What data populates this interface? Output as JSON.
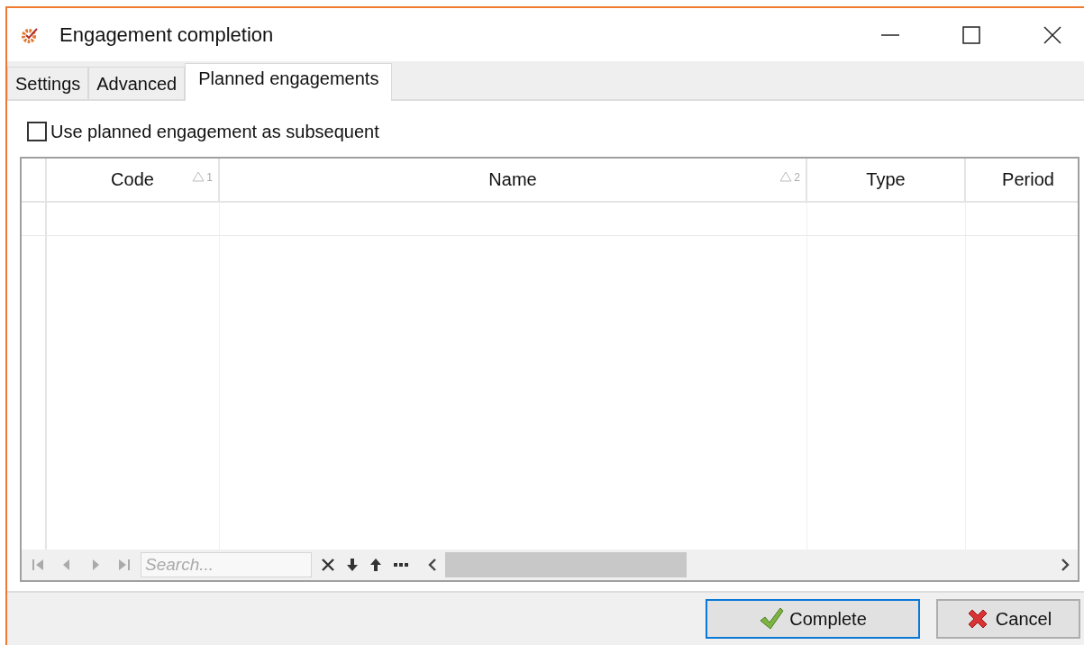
{
  "window": {
    "title": "Engagement completion"
  },
  "tabs": [
    {
      "label": "Settings",
      "selected": false
    },
    {
      "label": "Advanced",
      "selected": false
    },
    {
      "label": "Planned engagements",
      "selected": true
    }
  ],
  "option": {
    "label": "Use planned engagement as subsequent",
    "checked": false
  },
  "table": {
    "columns": [
      {
        "label": "Code",
        "sort_index": "1"
      },
      {
        "label": "Name",
        "sort_index": "2"
      },
      {
        "label": "Type"
      },
      {
        "label": "Period"
      }
    ]
  },
  "navigator": {
    "buttons": [
      {
        "kind": "first",
        "disabled": true
      },
      {
        "kind": "prev",
        "disabled": true
      },
      {
        "kind": "next",
        "disabled": true
      },
      {
        "kind": "last",
        "disabled": true
      }
    ],
    "search": {
      "placeholder": "Search..."
    }
  },
  "buttons": [
    {
      "label": "Complete",
      "kind": "ok",
      "focused": true
    },
    {
      "label": "Cancel",
      "kind": "cancel",
      "focused": false
    }
  ]
}
